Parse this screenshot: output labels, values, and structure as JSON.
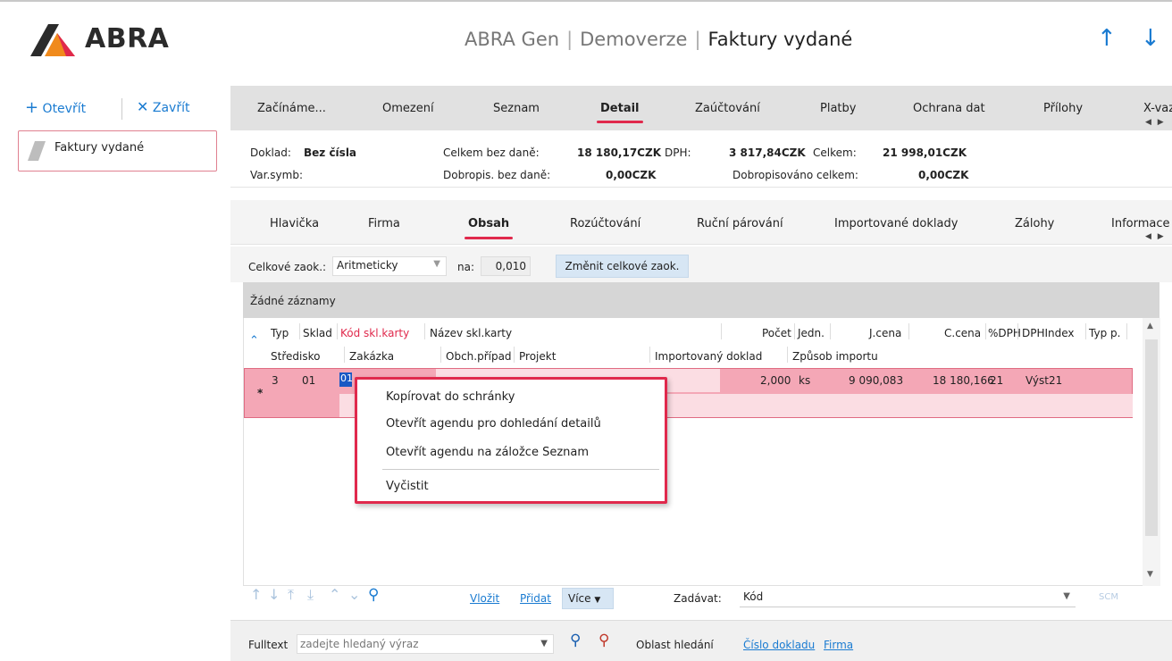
{
  "app": {
    "logo_text": "ABRA",
    "title_parts": [
      "ABRA Gen",
      "Demoverze",
      "Faktury vydané"
    ],
    "brand_color": "#e0294c",
    "accent_color": "#1a7bd1"
  },
  "left": {
    "open_label": "Otevřít",
    "close_label": "Zavřít",
    "agenda_label": "Faktury vydané"
  },
  "main_tabs": [
    "Začínáme...",
    "Omezení",
    "Seznam",
    "Detail",
    "Zaúčtování",
    "Platby",
    "Ochrana dat",
    "Přílohy",
    "X-vazby"
  ],
  "main_tab_active": "Detail",
  "summary": {
    "doklad_label": "Doklad:",
    "doklad_value": "Bez čísla",
    "varsymb_label": "Var.symb:",
    "celkem_bez_dane_label": "Celkem bez daně:",
    "celkem_bez_dane_value": "18 180,17CZK",
    "dph_label": "DPH:",
    "dph_value": "3 817,84CZK",
    "celkem_label": "Celkem:",
    "celkem_value": "21 998,01CZK",
    "dobropis_label": "Dobropis. bez daně:",
    "dobropis_value": "0,00CZK",
    "dobropisovano_label": "Dobropisováno celkem:",
    "dobropisovano_value": "0,00CZK"
  },
  "sub_tabs": [
    "Hlavička",
    "Firma",
    "Obsah",
    "Rozúčtování",
    "Ruční párování",
    "Importované doklady",
    "Zálohy",
    "Informace"
  ],
  "sub_tab_active": "Obsah",
  "rounding": {
    "label": "Celkové zaok.:",
    "select_value": "Aritmeticky",
    "na_label": "na:",
    "value": "0,010",
    "button_label": "Změnit celkové zaok."
  },
  "records_label": "Žádné záznamy",
  "grid": {
    "header_row1": [
      "Typ",
      "Sklad",
      "Kód skl.karty",
      "Název skl.karty",
      "Počet",
      "Jedn.",
      "J.cena",
      "C.cena",
      "%DPH",
      "DPHIndex",
      "Typ p."
    ],
    "header_row2": [
      "Středisko",
      "Zakázka",
      "Obch.případ",
      "Projekt",
      "Importovaný doklad",
      "Způsob importu"
    ],
    "row": {
      "typ": "3",
      "sklad": "01",
      "kod": "01",
      "pocet": "2,000",
      "jedn": "ks",
      "jcena": "9 090,083",
      "ccena": "18 180,166",
      "dph": "21",
      "dphindex": "Výst21",
      "marker": "*"
    }
  },
  "context_menu": [
    "Kopírovat do schránky",
    "Otevřít agendu pro dohledání detailů",
    "Otevřít agendu na záložce Seznam",
    "Vyčistit"
  ],
  "bottom": {
    "vlozit": "Vložit",
    "pridat": "Přidat",
    "vice": "Více",
    "zadavat_label": "Zadávat:",
    "zadavat_value": "Kód",
    "scm": "SCM"
  },
  "fulltext": {
    "label": "Fulltext",
    "placeholder": "zadejte hledaný výraz",
    "area_label": "Oblast hledání",
    "link1": "Číslo dokladu",
    "link2": "Firma"
  }
}
